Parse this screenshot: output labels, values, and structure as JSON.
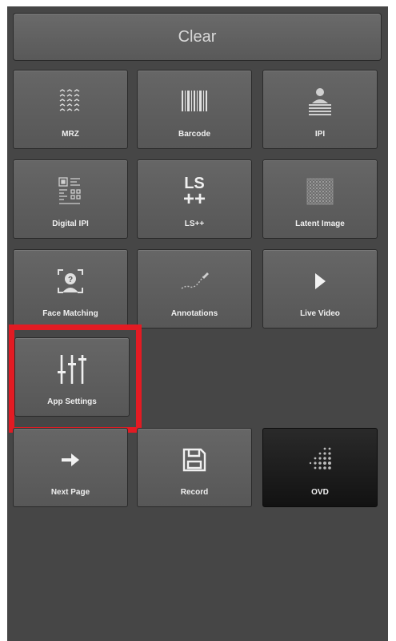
{
  "clear_label": "Clear",
  "accent_color": "#e31b23",
  "tiles": [
    {
      "label": "MRZ",
      "icon": "mrz-icon"
    },
    {
      "label": "Barcode",
      "icon": "barcode-icon"
    },
    {
      "label": "IPI",
      "icon": "ipi-icon"
    },
    {
      "label": "Digital IPI",
      "icon": "digital-ipi-icon"
    },
    {
      "label": "LS++",
      "icon": "ls-plus-icon"
    },
    {
      "label": "Latent Image",
      "icon": "latent-image-icon"
    },
    {
      "label": "Face Matching",
      "icon": "face-matching-icon"
    },
    {
      "label": "Annotations",
      "icon": "annotations-icon"
    },
    {
      "label": "Live Video",
      "icon": "play-icon"
    },
    {
      "label": "App Settings",
      "icon": "sliders-icon"
    },
    {
      "label": "Next Page",
      "icon": "arrow-right-icon"
    },
    {
      "label": "Record",
      "icon": "floppy-disk-icon"
    },
    {
      "label": "OVD",
      "icon": "ovd-dots-icon"
    }
  ],
  "ls_icon_text": {
    "top": "LS",
    "bottom": "++"
  }
}
